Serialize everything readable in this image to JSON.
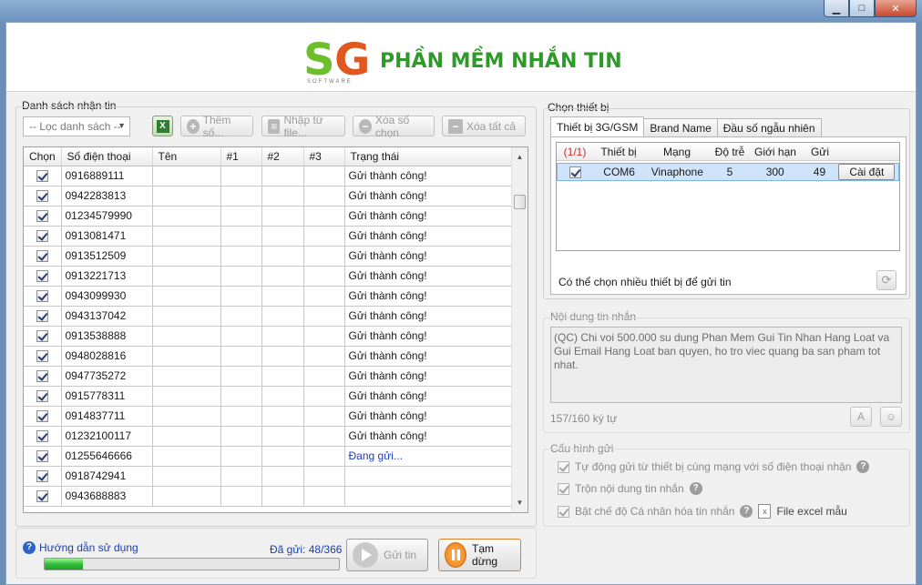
{
  "window": {
    "controls": {
      "minimize": "▁",
      "maximize": "□",
      "close": "✕"
    }
  },
  "header": {
    "logo_text_s": "S",
    "logo_text_g": "G",
    "logo_sub": "SOFTWARE",
    "title": "PHẦN MỀM NHẮN TIN"
  },
  "left_panel": {
    "group_label": "Danh sách nhận tin",
    "filter_combo": "-- Lọc danh sách --",
    "excel_icon": "excel-icon",
    "add_number_label": "Thêm số...",
    "import_file_label": "Nhập từ file...",
    "delete_selected_label": "Xóa số chọn",
    "delete_all_label": "Xóa tất cả",
    "columns": [
      "Chọn",
      "Số điện thoại",
      "Tên",
      "#1",
      "#2",
      "#3",
      "Trạng thái"
    ],
    "rows": [
      {
        "phone": "0916889111",
        "status": "Gửi thành công!"
      },
      {
        "phone": "0942283813",
        "status": "Gửi thành công!"
      },
      {
        "phone": "01234579990",
        "status": "Gửi thành công!"
      },
      {
        "phone": "0913081471",
        "status": "Gửi thành công!"
      },
      {
        "phone": "0913512509",
        "status": "Gửi thành công!"
      },
      {
        "phone": "0913221713",
        "status": "Gửi thành công!"
      },
      {
        "phone": "0943099930",
        "status": "Gửi thành công!"
      },
      {
        "phone": "0943137042",
        "status": "Gửi thành công!"
      },
      {
        "phone": "0913538888",
        "status": "Gửi thành công!"
      },
      {
        "phone": "0948028816",
        "status": "Gửi thành công!"
      },
      {
        "phone": "0947735272",
        "status": "Gửi thành công!"
      },
      {
        "phone": "0915778311",
        "status": "Gửi thành công!"
      },
      {
        "phone": "0914837711",
        "status": "Gửi thành công!"
      },
      {
        "phone": "01232100117",
        "status": "Gửi thành công!"
      },
      {
        "phone": "01255646666",
        "status": "Đang gửi..."
      },
      {
        "phone": "0918742941",
        "status": ""
      },
      {
        "phone": "0943688883",
        "status": ""
      }
    ]
  },
  "bottom": {
    "help_label": "Hướng dẫn sử dụng",
    "sent_label": "Đã gửi: 48/366",
    "progress_fraction": 0.13,
    "send_label": "Gửi tin",
    "pause_label": "Tạm dừng"
  },
  "device_panel": {
    "group_label": "Chọn thiết bị",
    "tabs": [
      "Thiết bị 3G/GSM",
      "Brand Name",
      "Đầu số ngẫu nhiên"
    ],
    "columns": [
      "(1/1)",
      "Thiết bị",
      "Mạng",
      "Độ trễ",
      "Giới hạn",
      "Gửi"
    ],
    "device": {
      "name": "COM6",
      "network": "Vinaphone",
      "delay": "5",
      "limit": "300",
      "sent": "49",
      "setup_label": "Cài đặt"
    },
    "note": "Có thể chọn nhiều thiết bị để gửi tin",
    "refresh_icon": "⟳"
  },
  "message_panel": {
    "label": "Nội dung tin nhắn",
    "content": "(QC) Chi voi 500.000 su dung Phan Mem Gui Tin Nhan Hang Loat va Gui Email Hang Loat ban quyen, ho tro viec quang ba san pham tot nhat.",
    "char_count": "157/160 ký tự",
    "font_btn": "A",
    "emoji_btn": "☺"
  },
  "config_panel": {
    "label": "Cấu hình gửi",
    "options": [
      "Tự động gửi từ thiết bị cùng mạng với số điện thoại nhận",
      "Trộn nội dung tin nhắn",
      "Bật chế độ Cá nhân hóa tin nhắn"
    ],
    "help_icon": "?",
    "excel_sample_label": "File excel mẫu"
  }
}
